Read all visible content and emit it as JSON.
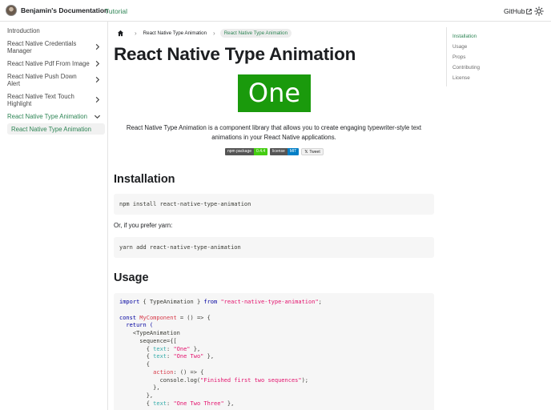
{
  "navbar": {
    "brand_title": "Benjamin's Documentation",
    "tutorial_link": "Tutorial",
    "github_link": "GitHub"
  },
  "sidebar": {
    "items": [
      {
        "label": "Introduction",
        "has_chevron": false
      },
      {
        "label": "React Native Credentials Manager",
        "has_chevron": true
      },
      {
        "label": "React Native Pdf From Image",
        "has_chevron": true
      },
      {
        "label": "React Native Push Down Alert",
        "has_chevron": true
      },
      {
        "label": "React Native Text Touch Highlight",
        "has_chevron": true
      },
      {
        "label": "React Native Type Animation",
        "has_chevron": true,
        "expanded": true
      }
    ],
    "subitem": "React Native Type Animation"
  },
  "breadcrumbs": {
    "parent": "React Native Type Animation",
    "current": "React Native Type Animation"
  },
  "page": {
    "title": "React Native Type Animation",
    "demo_text": "One",
    "intro": "React Native Type Animation is a component library that allows you to create engaging typewriter-style text animations in your React Native applications.",
    "badges": {
      "npm_label": "npm package",
      "npm_value": "0.4.4",
      "license_label": "license",
      "license_value": "MIT",
      "tweet_label": "Tweet"
    },
    "installation_heading": "Installation",
    "npm_command": "npm install react-native-type-animation",
    "yarn_note": "Or, if you prefer yarn:",
    "yarn_command": "yarn add react-native-type-animation",
    "usage_heading": "Usage",
    "usage_code": {
      "l1_import": "import",
      "l1_names": " { TypeAnimation } ",
      "l1_from": "from",
      "l1_module": "\"react-native-type-animation\"",
      "l1_end": ";",
      "l3_const": "const",
      "l3_name": "MyComponent",
      "l3_rest": " = () => {",
      "l4_return": "  return (",
      "l5_tag": "    <TypeAnimation",
      "l6_seq": "      sequence={[",
      "l7_open": "        { ",
      "l7_key": "text",
      "l7_colon": ": ",
      "l7_val": "\"One\"",
      "l7_close": " },",
      "l8_val": "\"One Two\"",
      "l9_brace": "        {",
      "l10_key": "action",
      "l10_rest": ": () => {",
      "l11_console": "            console.log(",
      "l11_str": "\"Finished first two sequences\"",
      "l11_end": ");",
      "l12": "          },",
      "l13": "        },",
      "l14_val": "\"One Two Three\""
    }
  },
  "toc": {
    "items": [
      "Installation",
      "Usage",
      "Props",
      "Contributing",
      "License"
    ]
  },
  "colors": {
    "accent": "#2e8555",
    "demo_green": "#1a9a0c",
    "code_bg": "#f6f6f6"
  }
}
